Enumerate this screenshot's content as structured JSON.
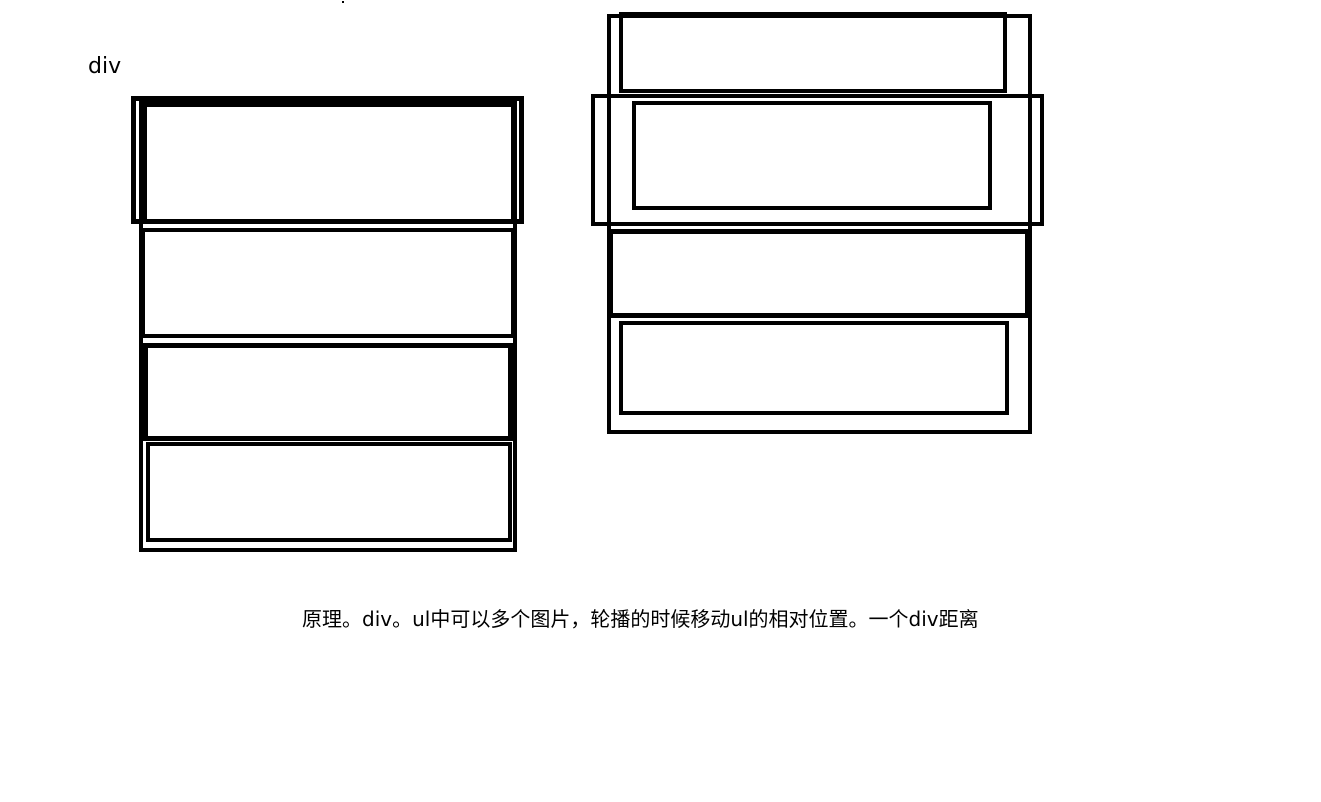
{
  "diagram": {
    "left_label": "div",
    "caption": "原理。div。ul中可以多个图片，轮播的时候移动ul的相对位置。一个div距离"
  }
}
